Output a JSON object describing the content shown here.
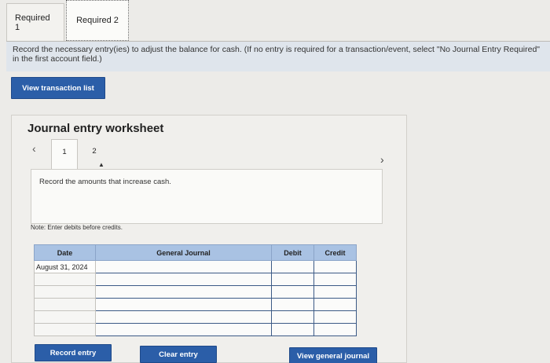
{
  "tabs": [
    {
      "label": "Required 1"
    },
    {
      "label": "Required 2"
    }
  ],
  "instructions": "Record the necessary entry(ies) to adjust the balance for cash. (If no entry is required for a transaction/event, select \"No Journal Entry Required\" in the first account field.)",
  "view_transaction_list": "View transaction list",
  "worksheet": {
    "title": "Journal entry worksheet",
    "steps": [
      "1",
      "2"
    ],
    "description": "Record the amounts that increase cash.",
    "note": "Note: Enter debits before credits.",
    "table": {
      "headers": {
        "date": "Date",
        "journal": "General Journal",
        "debit": "Debit",
        "credit": "Credit"
      },
      "rows": [
        {
          "date": "August 31, 2024",
          "account": "",
          "debit": "",
          "credit": ""
        },
        {
          "date": "",
          "account": "",
          "debit": "",
          "credit": ""
        },
        {
          "date": "",
          "account": "",
          "debit": "",
          "credit": ""
        },
        {
          "date": "",
          "account": "",
          "debit": "",
          "credit": ""
        },
        {
          "date": "",
          "account": "",
          "debit": "",
          "credit": ""
        },
        {
          "date": "",
          "account": "",
          "debit": "",
          "credit": ""
        }
      ]
    },
    "buttons": {
      "record": "Record entry",
      "clear": "Clear entry",
      "view_general_journal": "View general journal"
    }
  },
  "colors": {
    "accent": "#2b5ea8",
    "table_header": "#a9c2e3",
    "instruction_bg": "#dfe5ec"
  },
  "icons": {
    "prev": "chevron-left-icon",
    "next": "chevron-right-icon"
  }
}
